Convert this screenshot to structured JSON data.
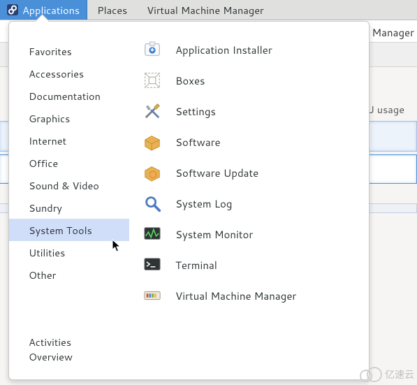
{
  "panel": {
    "applications": "Applications",
    "places": "Places",
    "vmm": "Virtual Machine Manager"
  },
  "window_title_peek": "Manager",
  "behind": {
    "cpu_label": "U usage"
  },
  "menu": {
    "categories": [
      {
        "label": "Favorites"
      },
      {
        "label": "Accessories"
      },
      {
        "label": "Documentation"
      },
      {
        "label": "Graphics"
      },
      {
        "label": "Internet"
      },
      {
        "label": "Office"
      },
      {
        "label": "Sound & Video"
      },
      {
        "label": "Sundry"
      },
      {
        "label": "System Tools",
        "selected": true
      },
      {
        "label": "Utilities"
      },
      {
        "label": "Other"
      }
    ],
    "activities": "Activities Overview",
    "apps": [
      {
        "label": "Application Installer",
        "icon": "installer-icon"
      },
      {
        "label": "Boxes",
        "icon": "boxes-icon"
      },
      {
        "label": "Settings",
        "icon": "settings-icon"
      },
      {
        "label": "Software",
        "icon": "software-icon"
      },
      {
        "label": "Software Update",
        "icon": "update-icon"
      },
      {
        "label": "System Log",
        "icon": "log-icon"
      },
      {
        "label": "System Monitor",
        "icon": "monitor-icon"
      },
      {
        "label": "Terminal",
        "icon": "terminal-icon"
      },
      {
        "label": "Virtual Machine Manager",
        "icon": "vmm-icon"
      }
    ]
  },
  "watermark": "亿速云"
}
